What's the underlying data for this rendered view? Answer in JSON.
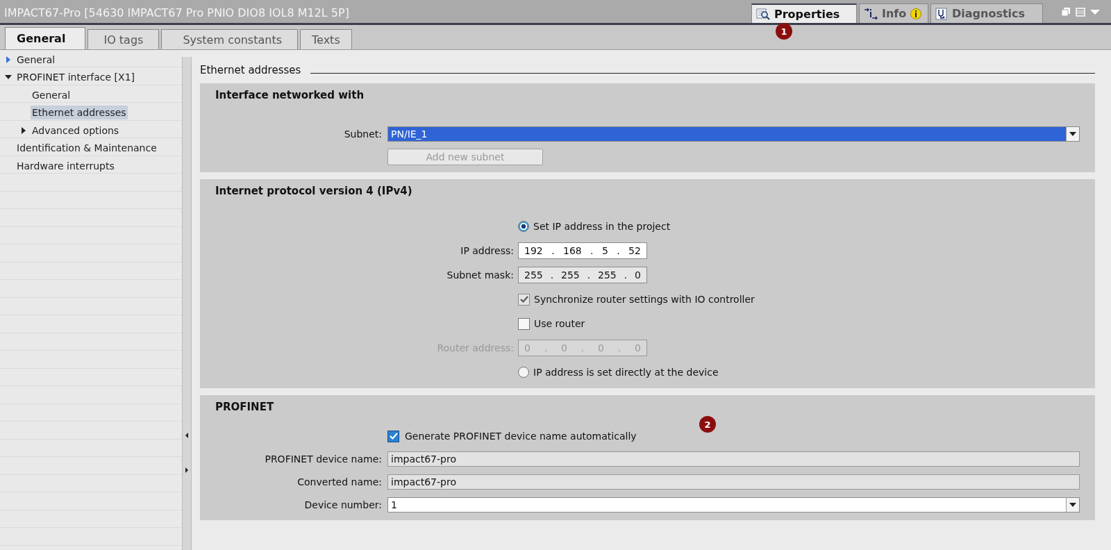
{
  "window": {
    "title": "IMPACT67-Pro [54630 IMPACT67 Pro PNIO DIO8 IOL8 M12L 5P]"
  },
  "view_tabs": [
    {
      "label": "Properties",
      "selected": true,
      "info_badge": false
    },
    {
      "label": "Info",
      "selected": false,
      "info_badge": true
    },
    {
      "label": "Diagnostics",
      "selected": false,
      "info_badge": false
    }
  ],
  "tabs": [
    {
      "label": "General",
      "selected": true
    },
    {
      "label": "IO tags",
      "selected": false
    },
    {
      "label": "System constants",
      "selected": false
    },
    {
      "label": "Texts",
      "selected": false
    }
  ],
  "sidebar": {
    "items": [
      {
        "label": "General",
        "expanded": false,
        "selected": false
      },
      {
        "label": "PROFINET interface [X1]",
        "expanded": true,
        "selected": false,
        "children": [
          {
            "label": "General",
            "selected": false
          },
          {
            "label": "Ethernet addresses",
            "selected": true
          },
          {
            "label": "Advanced options",
            "expanded": false,
            "selected": false
          }
        ]
      },
      {
        "label": "Identification & Maintenance",
        "selected": false
      },
      {
        "label": "Hardware interrupts",
        "selected": false
      }
    ]
  },
  "content": {
    "heading": "Ethernet addresses",
    "interface_section": {
      "title": "Interface networked with",
      "subnet_label": "Subnet:",
      "subnet_value": "PN/IE_1",
      "add_subnet_button": {
        "label": "Add new subnet",
        "disabled": true
      }
    },
    "ipv4_section": {
      "title": "Internet protocol version 4 (IPv4)",
      "rows": [
        {
          "kind": "radio",
          "label": "Set IP address in the project",
          "selected": true
        },
        {
          "kind": "ip",
          "label": "IP address:",
          "octets": [
            "192",
            "168",
            "5",
            "52"
          ],
          "separator": ".",
          "disabled": false,
          "white": true
        },
        {
          "kind": "ip",
          "label": "Subnet mask:",
          "octets": [
            "255",
            "255",
            "255",
            "0"
          ],
          "separator": ".",
          "disabled": false,
          "white": false
        },
        {
          "kind": "checkbox",
          "label": "Synchronize router settings with IO controller",
          "checked": true,
          "disabled": true
        },
        {
          "kind": "checkbox",
          "label": "Use router",
          "checked": false,
          "disabled": false
        },
        {
          "kind": "ip",
          "label": "Router address:",
          "octets": [
            "0",
            "0",
            "0",
            "0"
          ],
          "separator": ".",
          "disabled": true,
          "white": false
        },
        {
          "kind": "radio",
          "label": "IP address is set directly at the device",
          "selected": false
        }
      ]
    },
    "profinet_section": {
      "title": "PROFINET",
      "rows": [
        {
          "kind": "checkbox",
          "label": "Generate PROFINET device name automatically",
          "checked": true,
          "disabled": false
        },
        {
          "kind": "text",
          "label": "PROFINET device name:",
          "value": "impact67-pro",
          "readonly": true
        },
        {
          "kind": "text",
          "label": "Converted name:",
          "value": "impact67-pro",
          "readonly": true
        },
        {
          "kind": "dropdown",
          "label": "Device number:",
          "value": "1"
        }
      ]
    }
  },
  "callouts": [
    "1",
    "2"
  ]
}
